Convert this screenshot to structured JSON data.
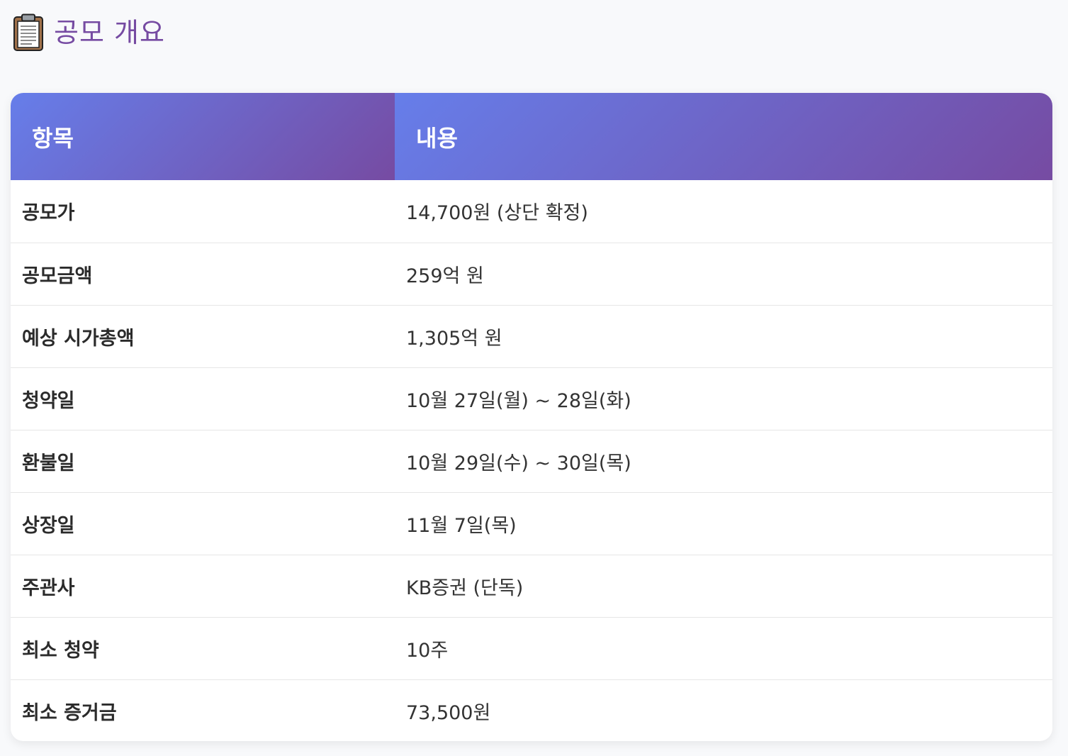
{
  "heading": {
    "icon": "clipboard-icon",
    "title": "공모 개요"
  },
  "colors": {
    "title": "#764ba2",
    "header_gradient_start": "#667eea",
    "header_gradient_end": "#764ba2"
  },
  "table": {
    "headers": [
      "항목",
      "내용"
    ],
    "rows": [
      {
        "item": "공모가",
        "value": "14,700원 (상단 확정)"
      },
      {
        "item": "공모금액",
        "value": "259억 원"
      },
      {
        "item": "예상 시가총액",
        "value": "1,305억 원"
      },
      {
        "item": "청약일",
        "value": "10월 27일(월) ~ 28일(화)"
      },
      {
        "item": "환불일",
        "value": "10월 29일(수) ~ 30일(목)"
      },
      {
        "item": "상장일",
        "value": "11월 7일(목)"
      },
      {
        "item": "주관사",
        "value": "KB증권 (단독)"
      },
      {
        "item": "최소 청약",
        "value": "10주"
      },
      {
        "item": "최소 증거금",
        "value": "73,500원"
      }
    ]
  }
}
